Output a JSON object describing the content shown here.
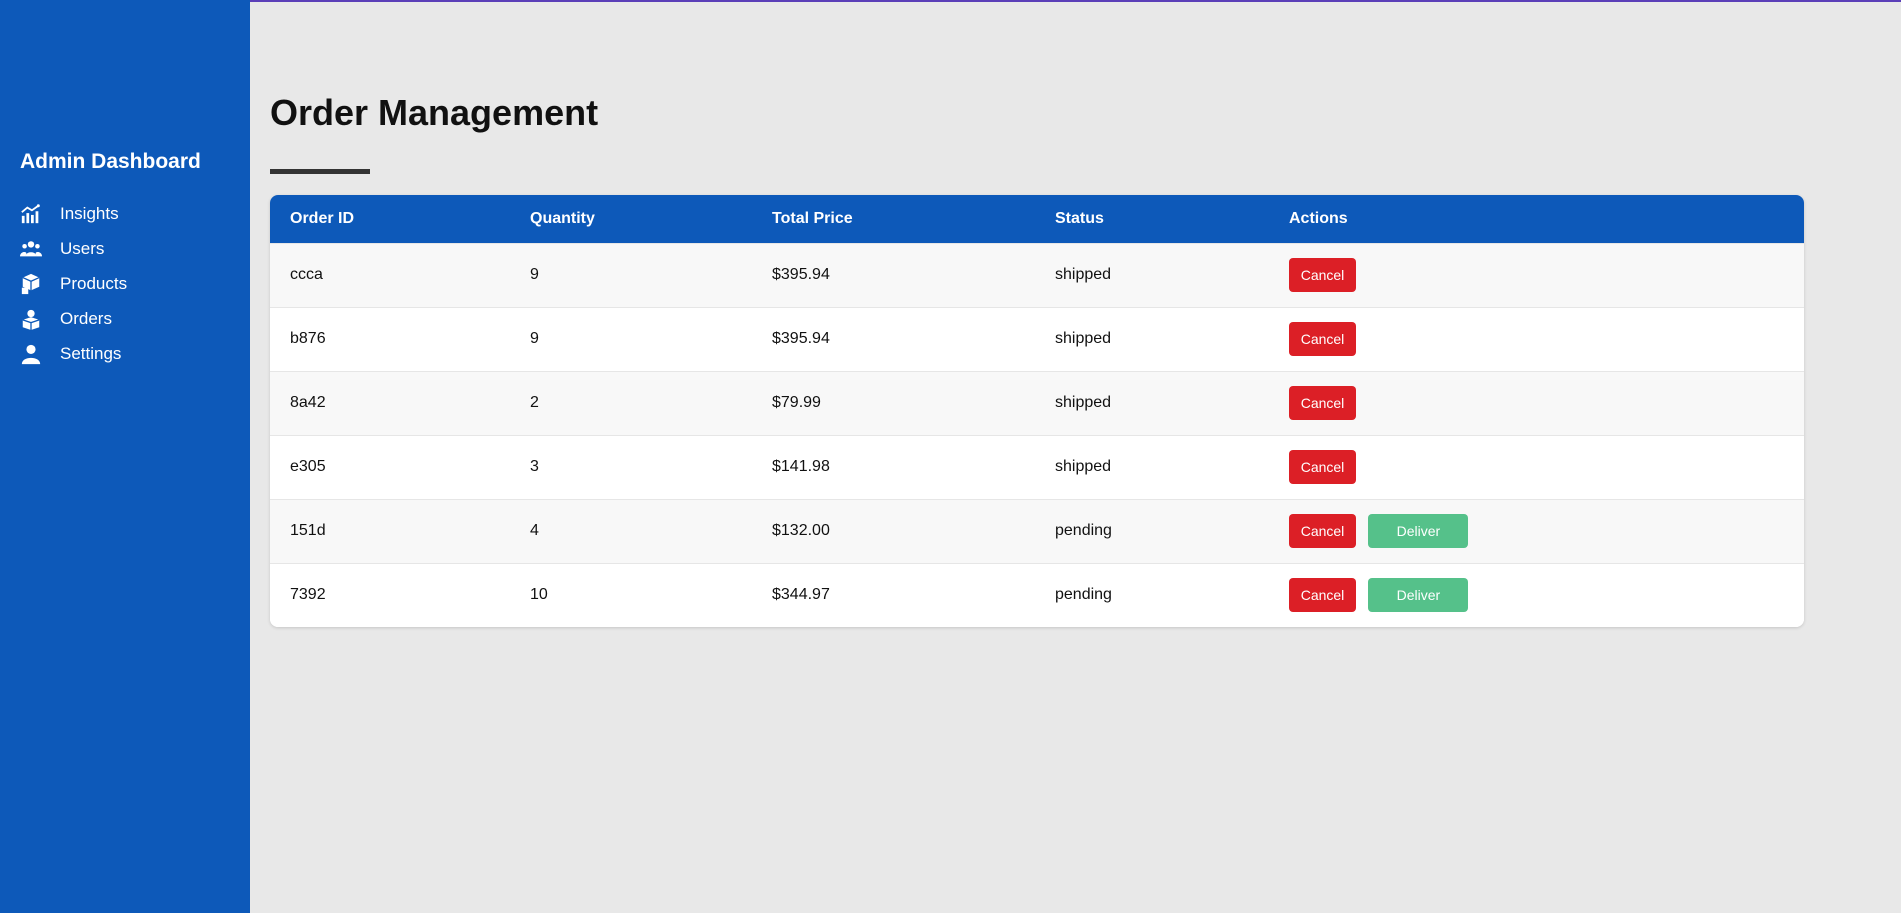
{
  "colors": {
    "sidebar": "#0d59b9",
    "header": "#0d59b9",
    "cancel": "#dc1f26",
    "deliver": "#55c18a",
    "background": "#e8e8e8"
  },
  "sidebar": {
    "brand": "Admin Dashboard",
    "items": [
      {
        "label": "Insights",
        "icon": "chart-icon"
      },
      {
        "label": "Users",
        "icon": "users-icon"
      },
      {
        "label": "Products",
        "icon": "boxes-icon"
      },
      {
        "label": "Orders",
        "icon": "orders-icon"
      },
      {
        "label": "Settings",
        "icon": "user-icon"
      }
    ]
  },
  "main": {
    "title": "Order Management",
    "table": {
      "columns": [
        "Order ID",
        "Quantity",
        "Total Price",
        "Status",
        "Actions"
      ],
      "rows": [
        {
          "id": "ccca",
          "quantity": "9",
          "price": "$395.94",
          "status": "shipped",
          "cancel": "Cancel"
        },
        {
          "id": "b876",
          "quantity": "9",
          "price": "$395.94",
          "status": "shipped",
          "cancel": "Cancel"
        },
        {
          "id": "8a42",
          "quantity": "2",
          "price": "$79.99",
          "status": "shipped",
          "cancel": "Cancel"
        },
        {
          "id": "e305",
          "quantity": "3",
          "price": "$141.98",
          "status": "shipped",
          "cancel": "Cancel"
        },
        {
          "id": "151d",
          "quantity": "4",
          "price": "$132.00",
          "status": "pending",
          "cancel": "Cancel",
          "deliver": "Deliver"
        },
        {
          "id": "7392",
          "quantity": "10",
          "price": "$344.97",
          "status": "pending",
          "cancel": "Cancel",
          "deliver": "Deliver"
        }
      ]
    }
  }
}
